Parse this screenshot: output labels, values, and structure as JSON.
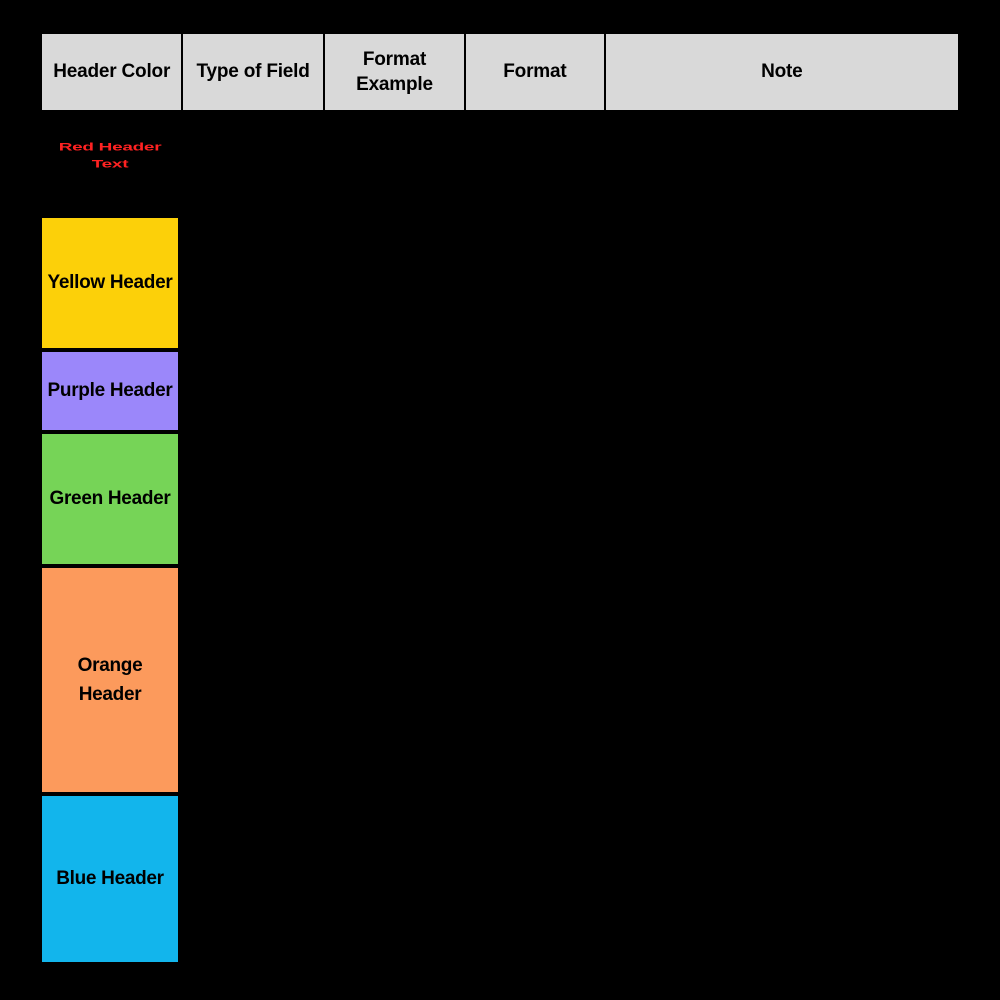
{
  "table": {
    "columns": [
      {
        "id": "header-color",
        "label": "Header Color"
      },
      {
        "id": "type-of-field",
        "label": "Type of Field"
      },
      {
        "id": "format-example",
        "label": "Format Example"
      },
      {
        "id": "format",
        "label": "Format"
      },
      {
        "id": "note",
        "label": "Note"
      }
    ],
    "header_background": "#d9d9d9",
    "border_color": "#000000",
    "page_background": "#000000",
    "rows": [
      {
        "id": "red",
        "label": "Red Header Text",
        "swatch_color": "#000000",
        "text_color": "#ff2222",
        "type_of_field": "",
        "format_example": "",
        "format": "",
        "note": ""
      },
      {
        "id": "yellow",
        "label": "Yellow Header",
        "swatch_color": "#fcd009",
        "text_color": "#000000",
        "type_of_field": "",
        "format_example": "",
        "format": "",
        "note": ""
      },
      {
        "id": "purple",
        "label": "Purple Header",
        "swatch_color": "#9b87fa",
        "text_color": "#000000",
        "type_of_field": "",
        "format_example": "",
        "format": "",
        "note": ""
      },
      {
        "id": "green",
        "label": "Green Header",
        "swatch_color": "#76d457",
        "text_color": "#000000",
        "type_of_field": "",
        "format_example": "",
        "format": "",
        "note": ""
      },
      {
        "id": "orange",
        "label": "Orange Header",
        "swatch_color": "#fc9a5c",
        "text_color": "#000000",
        "type_of_field": "",
        "format_example": "",
        "format": "",
        "note": ""
      },
      {
        "id": "blue",
        "label": "Blue Header",
        "swatch_color": "#12b5ec",
        "text_color": "#000000",
        "type_of_field": "",
        "format_example": "",
        "format": "",
        "note": ""
      }
    ]
  }
}
